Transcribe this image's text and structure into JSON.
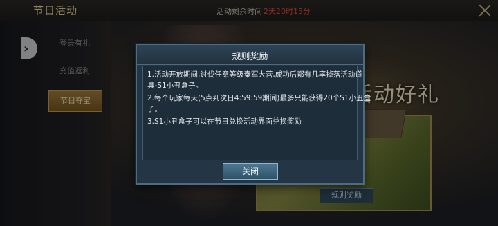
{
  "header": {
    "title": "节日活动",
    "timer_label": "活动剩余时间",
    "timer_value": "2天20时15分",
    "timer_color": "#e0473c"
  },
  "sidebar": {
    "items": [
      {
        "label": "登录有礼",
        "active": false
      },
      {
        "label": "充值返利",
        "active": false
      },
      {
        "label": "节日夺宝",
        "active": true
      }
    ]
  },
  "banner": {
    "title": "活动好礼",
    "rules_button": "规则奖励"
  },
  "modal": {
    "title": "规则奖励",
    "lines": [
      "1.活动开放期间,讨伐任意等级秦军大营,成功后都有几率掉落活动道",
      "具-S1小丑盒子。",
      "2.每个玩家每天(5点到次日4:59:59期间)最多只能获得20个S1小丑盒",
      "子。",
      "3.S1小丑盒子可以在节日兑换活动界面兑换奖励"
    ],
    "close_button": "关闭"
  },
  "icons": {
    "close": "close-icon",
    "toggle": "chevron-right-icon"
  },
  "colors": {
    "accent_gold": "#c49a4e",
    "modal_bg": "#243645",
    "modal_border": "#4b6c82"
  }
}
